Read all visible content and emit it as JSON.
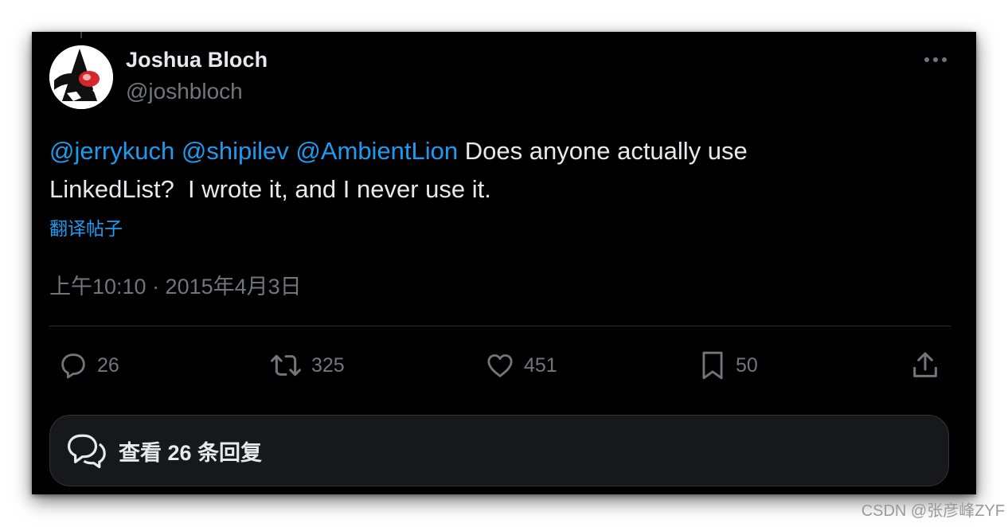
{
  "post": {
    "author_name": "Joshua Bloch",
    "author_handle": "@joshbloch",
    "mentions": [
      "@jerrykuch",
      "@shipilev",
      "@AmbientLion"
    ],
    "text_line1": "Does anyone actually use",
    "text_line2": "LinkedList?  I wrote it, and I never use it.",
    "translate_label": "翻译帖子",
    "timestamp": "上午10:10 · 2015年4月3日"
  },
  "actions": {
    "reply_count": "26",
    "repost_count": "325",
    "like_count": "451",
    "bookmark_count": "50"
  },
  "view_replies_label": "查看 26 条回复",
  "watermark": "CSDN @张彦峰ZYF",
  "colors": {
    "background": "#000000",
    "text": "#e7e9ea",
    "secondary": "#71767b",
    "link": "#1d9bf0",
    "border": "#2f3336"
  },
  "icons": [
    "more-icon",
    "reply-icon",
    "repost-icon",
    "like-icon",
    "bookmark-icon",
    "share-icon",
    "chat-bubble-icon"
  ]
}
